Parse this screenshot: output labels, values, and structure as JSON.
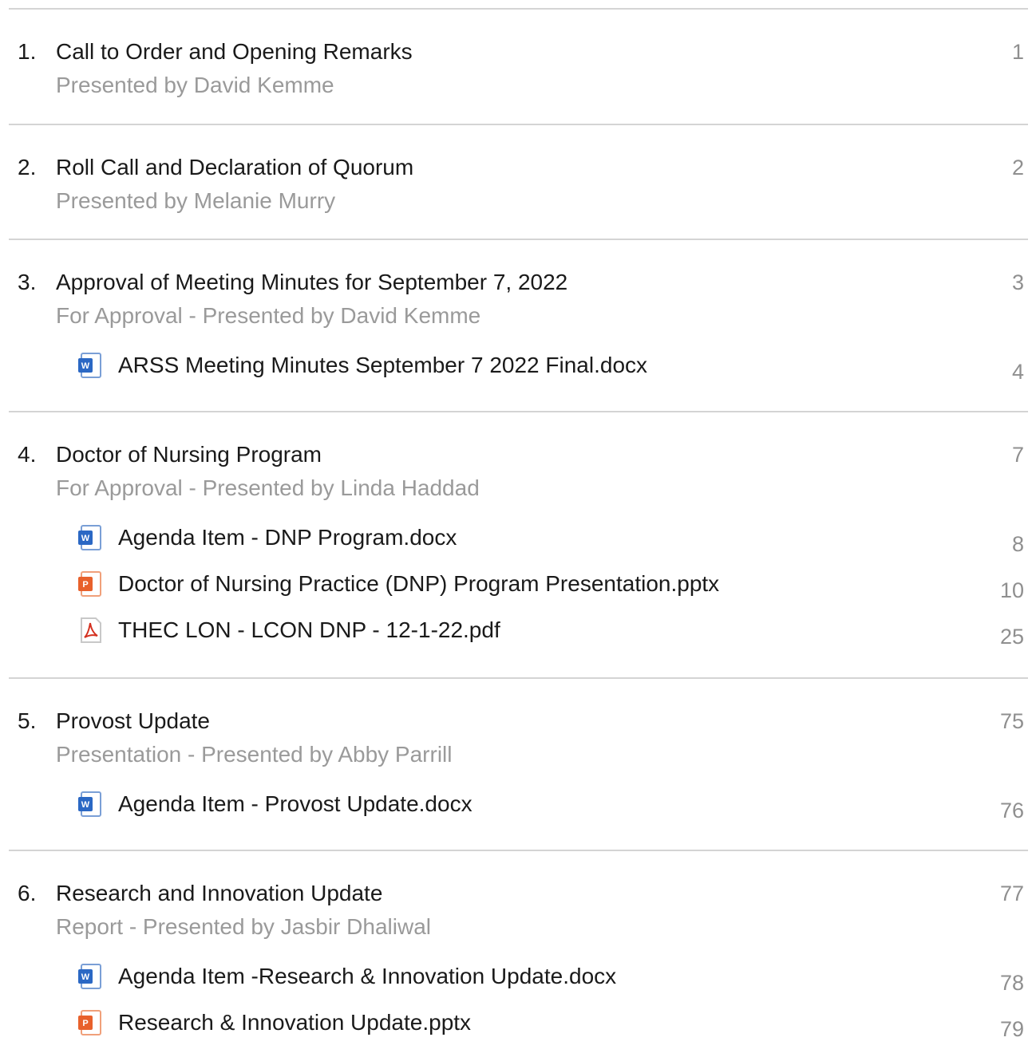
{
  "agenda": {
    "items": [
      {
        "number": "1.",
        "title": "Call to Order and Opening Remarks",
        "subtitle": "Presented by David Kemme",
        "page": "1",
        "attachments": []
      },
      {
        "number": "2.",
        "title": "Roll Call and Declaration of Quorum",
        "subtitle": "Presented by Melanie Murry",
        "page": "2",
        "attachments": []
      },
      {
        "number": "3.",
        "title": "Approval of Meeting Minutes for September 7, 2022",
        "subtitle": "For Approval - Presented by David Kemme",
        "page": "3",
        "attachments": [
          {
            "name": "ARSS Meeting Minutes September 7 2022 Final.docx",
            "icon": "word-doc-icon",
            "page": "4"
          }
        ]
      },
      {
        "number": "4.",
        "title": "Doctor of Nursing Program",
        "subtitle": "For Approval - Presented by Linda Haddad",
        "page": "7",
        "attachments": [
          {
            "name": "Agenda Item - DNP Program.docx",
            "icon": "word-doc-icon",
            "page": "8"
          },
          {
            "name": "Doctor of Nursing Practice (DNP) Program Presentation.pptx",
            "icon": "powerpoint-icon",
            "page": "10"
          },
          {
            "name": "THEC LON - LCON DNP - 12-1-22.pdf",
            "icon": "pdf-icon",
            "page": "25"
          }
        ]
      },
      {
        "number": "5.",
        "title": "Provost Update",
        "subtitle": "Presentation - Presented by Abby Parrill",
        "page": "75",
        "attachments": [
          {
            "name": "Agenda Item - Provost Update.docx",
            "icon": "word-doc-icon",
            "page": "76"
          }
        ]
      },
      {
        "number": "6.",
        "title": "Research and Innovation Update",
        "subtitle": "Report - Presented by Jasbir Dhaliwal",
        "page": "77",
        "attachments": [
          {
            "name": "Agenda Item -Research & Innovation Update.docx",
            "icon": "word-doc-icon",
            "page": "78"
          },
          {
            "name": "Research & Innovation Update.pptx",
            "icon": "powerpoint-icon",
            "page": "79"
          }
        ]
      }
    ]
  },
  "colors": {
    "divider": "#d4d4d4",
    "text": "#1a1a1a",
    "muted": "#9a9a9a",
    "page_number": "#8f8f8f",
    "word_blue": "#2b68c4",
    "ppt_orange": "#e8612c",
    "pdf_red": "#d4301f"
  }
}
